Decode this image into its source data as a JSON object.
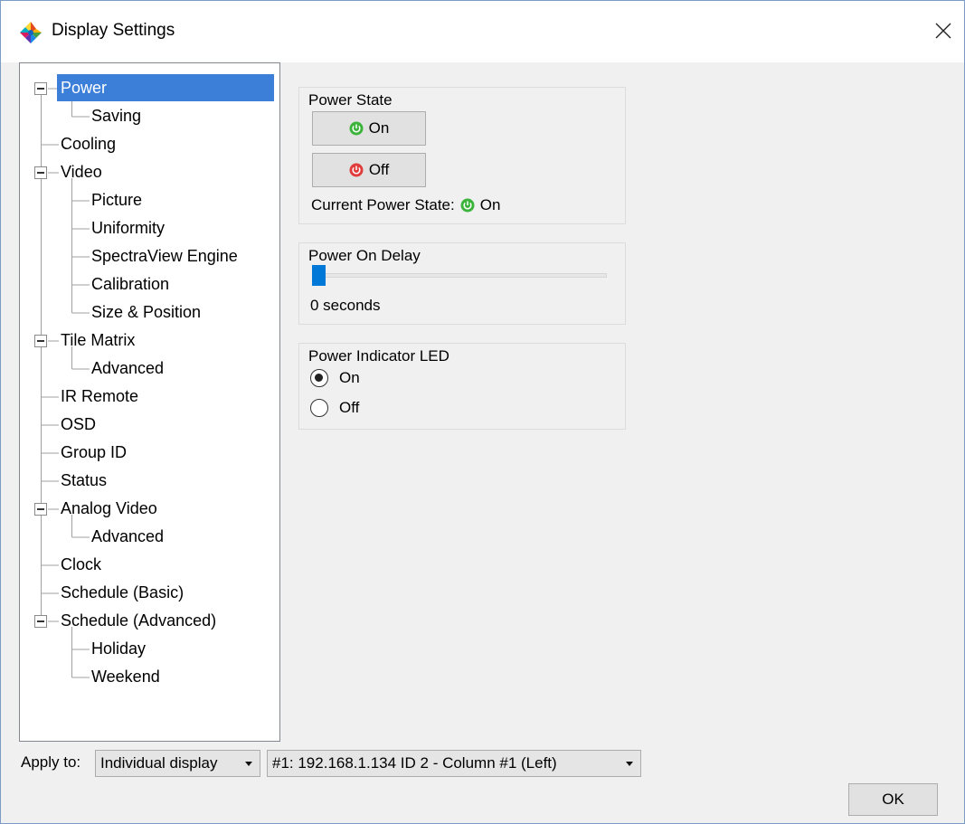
{
  "window": {
    "title": "Display Settings"
  },
  "tree": {
    "items": [
      {
        "label": "Power",
        "selected": true,
        "expanded": true
      },
      {
        "label": "Saving"
      },
      {
        "label": "Cooling"
      },
      {
        "label": "Video",
        "expanded": true
      },
      {
        "label": "Picture"
      },
      {
        "label": "Uniformity"
      },
      {
        "label": "SpectraView Engine"
      },
      {
        "label": "Calibration"
      },
      {
        "label": "Size & Position"
      },
      {
        "label": "Tile Matrix",
        "expanded": true
      },
      {
        "label": "Advanced"
      },
      {
        "label": "IR Remote"
      },
      {
        "label": "OSD"
      },
      {
        "label": "Group ID"
      },
      {
        "label": "Status"
      },
      {
        "label": "Analog Video",
        "expanded": true
      },
      {
        "label": "Advanced"
      },
      {
        "label": "Clock"
      },
      {
        "label": "Schedule (Basic)"
      },
      {
        "label": "Schedule (Advanced)",
        "expanded": true
      },
      {
        "label": "Holiday"
      },
      {
        "label": "Weekend"
      }
    ]
  },
  "power_state": {
    "title": "Power State",
    "on_label": "On",
    "off_label": "Off",
    "current_label": "Current Power State:",
    "current_value": "On",
    "on_color": "#3cb43c",
    "off_color": "#e03c3c",
    "icon": "power-icon"
  },
  "power_on_delay": {
    "title": "Power On Delay",
    "value_text": "0 seconds",
    "slider_value": 0,
    "accent": "#0078d7"
  },
  "power_led": {
    "title": "Power Indicator LED",
    "options": [
      {
        "label": "On",
        "checked": true
      },
      {
        "label": "Off",
        "checked": false
      }
    ]
  },
  "footer": {
    "apply_label": "Apply to:",
    "apply_value": "Individual display",
    "display_value": "#1: 192.168.1.134 ID 2 - Column #1 (Left)",
    "ok_label": "OK"
  }
}
